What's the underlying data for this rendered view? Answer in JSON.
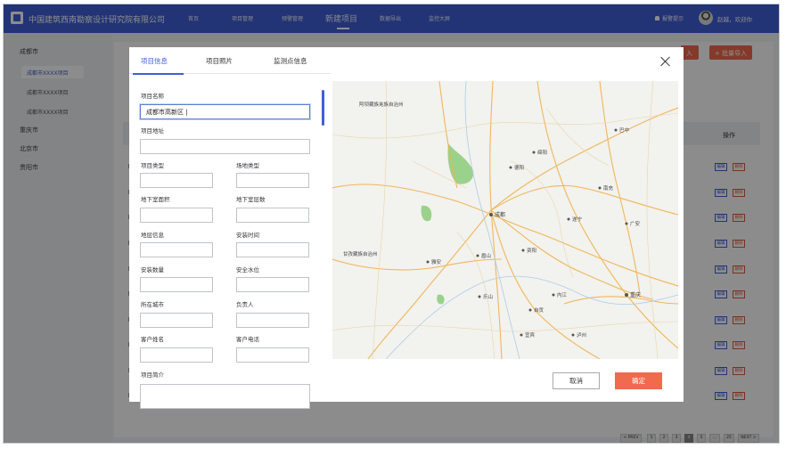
{
  "header": {
    "title": "中国建筑西南勘察设计研究院有限公司",
    "nav": [
      "首页",
      "项目管理",
      "预警管理",
      "新建项目",
      "数据导出",
      "监控大屏"
    ],
    "active_nav": "新建项目",
    "alarm_label": "报警提示",
    "greeting": "赵越，欢迎你"
  },
  "sidebar": {
    "cities": [
      {
        "label": "成都市",
        "children": [
          "成都市XXXX项目",
          "成都市XXXX项目",
          "成都市XXXX项目"
        ]
      },
      {
        "label": "重庆市"
      },
      {
        "label": "北京市"
      },
      {
        "label": "贵阳市"
      }
    ]
  },
  "background": {
    "import_button_partial": "入",
    "batch_import_button": "+ 批量导入",
    "column_operation": "操作",
    "row_edit_label": "编辑",
    "row_delete_label": "删除",
    "pagination": {
      "prev": "< PREV",
      "pages": [
        "1",
        "2",
        "3",
        "4",
        "5",
        "...",
        "25"
      ],
      "current": "4",
      "next": "NEXT >"
    }
  },
  "modal": {
    "tabs": [
      "项目信息",
      "项目照片",
      "监测点信息"
    ],
    "active_tab": "项目信息",
    "fields": {
      "project_name": {
        "label": "项目名称",
        "value": "成都市高新区 |"
      },
      "project_address": {
        "label": "项目地址",
        "value": ""
      },
      "project_type": {
        "label": "项目类型",
        "value": ""
      },
      "site_type": {
        "label": "场地类型",
        "value": ""
      },
      "basement_area": {
        "label": "地下室面积",
        "value": ""
      },
      "basement_floors": {
        "label": "地下室层数",
        "value": ""
      },
      "geology_info": {
        "label": "地层信息",
        "value": ""
      },
      "install_time": {
        "label": "安装时间",
        "value": ""
      },
      "install_count": {
        "label": "安装数量",
        "value": ""
      },
      "safe_water_level": {
        "label": "安全水位",
        "value": ""
      },
      "city": {
        "label": "所在城市",
        "value": ""
      },
      "owner": {
        "label": "负责人",
        "value": ""
      },
      "customer_name": {
        "label": "客户姓名",
        "value": ""
      },
      "customer_phone": {
        "label": "客户电话",
        "value": ""
      },
      "project_intro": {
        "label": "项目简介",
        "value": ""
      }
    },
    "map_labels": [
      "阿坝藏族羌族自治州",
      "甘孜藏族自治州",
      "成都",
      "德阳",
      "绵阳",
      "雅安",
      "眉山",
      "乐山",
      "资阳",
      "遂宁",
      "内江",
      "自贡",
      "宜宾",
      "泸州",
      "重庆",
      "广安",
      "南充",
      "巴中"
    ],
    "cancel_label": "取消",
    "confirm_label": "确定"
  }
}
